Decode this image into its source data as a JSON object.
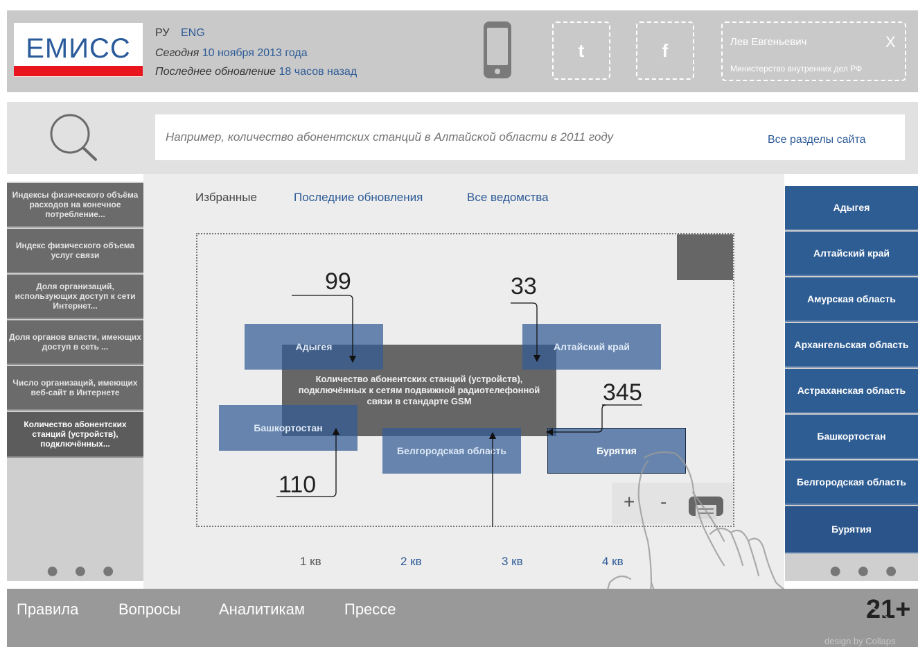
{
  "header": {
    "logo": "ЕМИСС",
    "lang_ru": "РУ",
    "lang_eng": "ENG",
    "today_label": "Сегодня",
    "today_value": "10 ноября 2013 года",
    "updated_label": "Последнее обновление",
    "updated_value": "18 часов назад",
    "social_twitter": "t",
    "social_facebook": "f",
    "user_name": "Лев Евгеньевич",
    "user_close": "X",
    "user_org": "Министерство внутренних дел РФ"
  },
  "search": {
    "placeholder": "Например, количество абонентских станций в Алтайской области в 2011 году",
    "all_sections": "Все разделы сайта"
  },
  "left_sidebar": {
    "items": [
      {
        "label": "Индексы физического объёма расходов на конечное потребление..."
      },
      {
        "label": "Индекс физического объема услуг связи"
      },
      {
        "label": "Доля организаций, использующих доступ к сети Интернет..."
      },
      {
        "label": "Доля органов власти, имеющих доступ в сеть ..."
      },
      {
        "label": "Число организаций, имеющих веб-сайт в Интернете"
      },
      {
        "label": "Количество абонентских станций (устройств), подключённых..."
      }
    ],
    "more": "● ● ●"
  },
  "tabs": [
    {
      "label": "Избранные"
    },
    {
      "label": "Последние обновления"
    },
    {
      "label": "Все ведомства"
    }
  ],
  "visualization": {
    "center_text": "Количество абонентских станций (устройств), подключённых к сетям подвижной радиотелефонной связи в стандарте GSM",
    "regions": [
      {
        "name": "Адыгея",
        "value": "99"
      },
      {
        "name": "Алтайский край",
        "value": "33"
      },
      {
        "name": "Башкортостан",
        "value": "110"
      },
      {
        "name": "Белгородская область",
        "value": ""
      },
      {
        "name": "Бурятия",
        "value": "345"
      }
    ],
    "zoom_in": "+",
    "zoom_out": "-"
  },
  "quarters": [
    "1 кв",
    "2 кв",
    "3 кв",
    "4 кв"
  ],
  "right_sidebar": {
    "items": [
      {
        "label": "Адыгея"
      },
      {
        "label": "Алтайский край"
      },
      {
        "label": "Амурская область"
      },
      {
        "label": "Архангельская область"
      },
      {
        "label": "Астраханская область"
      },
      {
        "label": "Башкортостан"
      },
      {
        "label": "Белгородская область"
      },
      {
        "label": "Бурятия"
      }
    ],
    "more": "● ● ●"
  },
  "footer": {
    "links": [
      {
        "label": "Правила"
      },
      {
        "label": "Вопросы"
      },
      {
        "label": "Аналитикам"
      },
      {
        "label": "Прессе"
      }
    ],
    "age_rating": "21+",
    "credit": "design by Collaps"
  },
  "colors": {
    "brand_blue": "#2c5a96",
    "brand_red": "#e8141e",
    "sidebar_blue": "#2e5d93",
    "sidebar_gray": "#6b6b6b"
  }
}
